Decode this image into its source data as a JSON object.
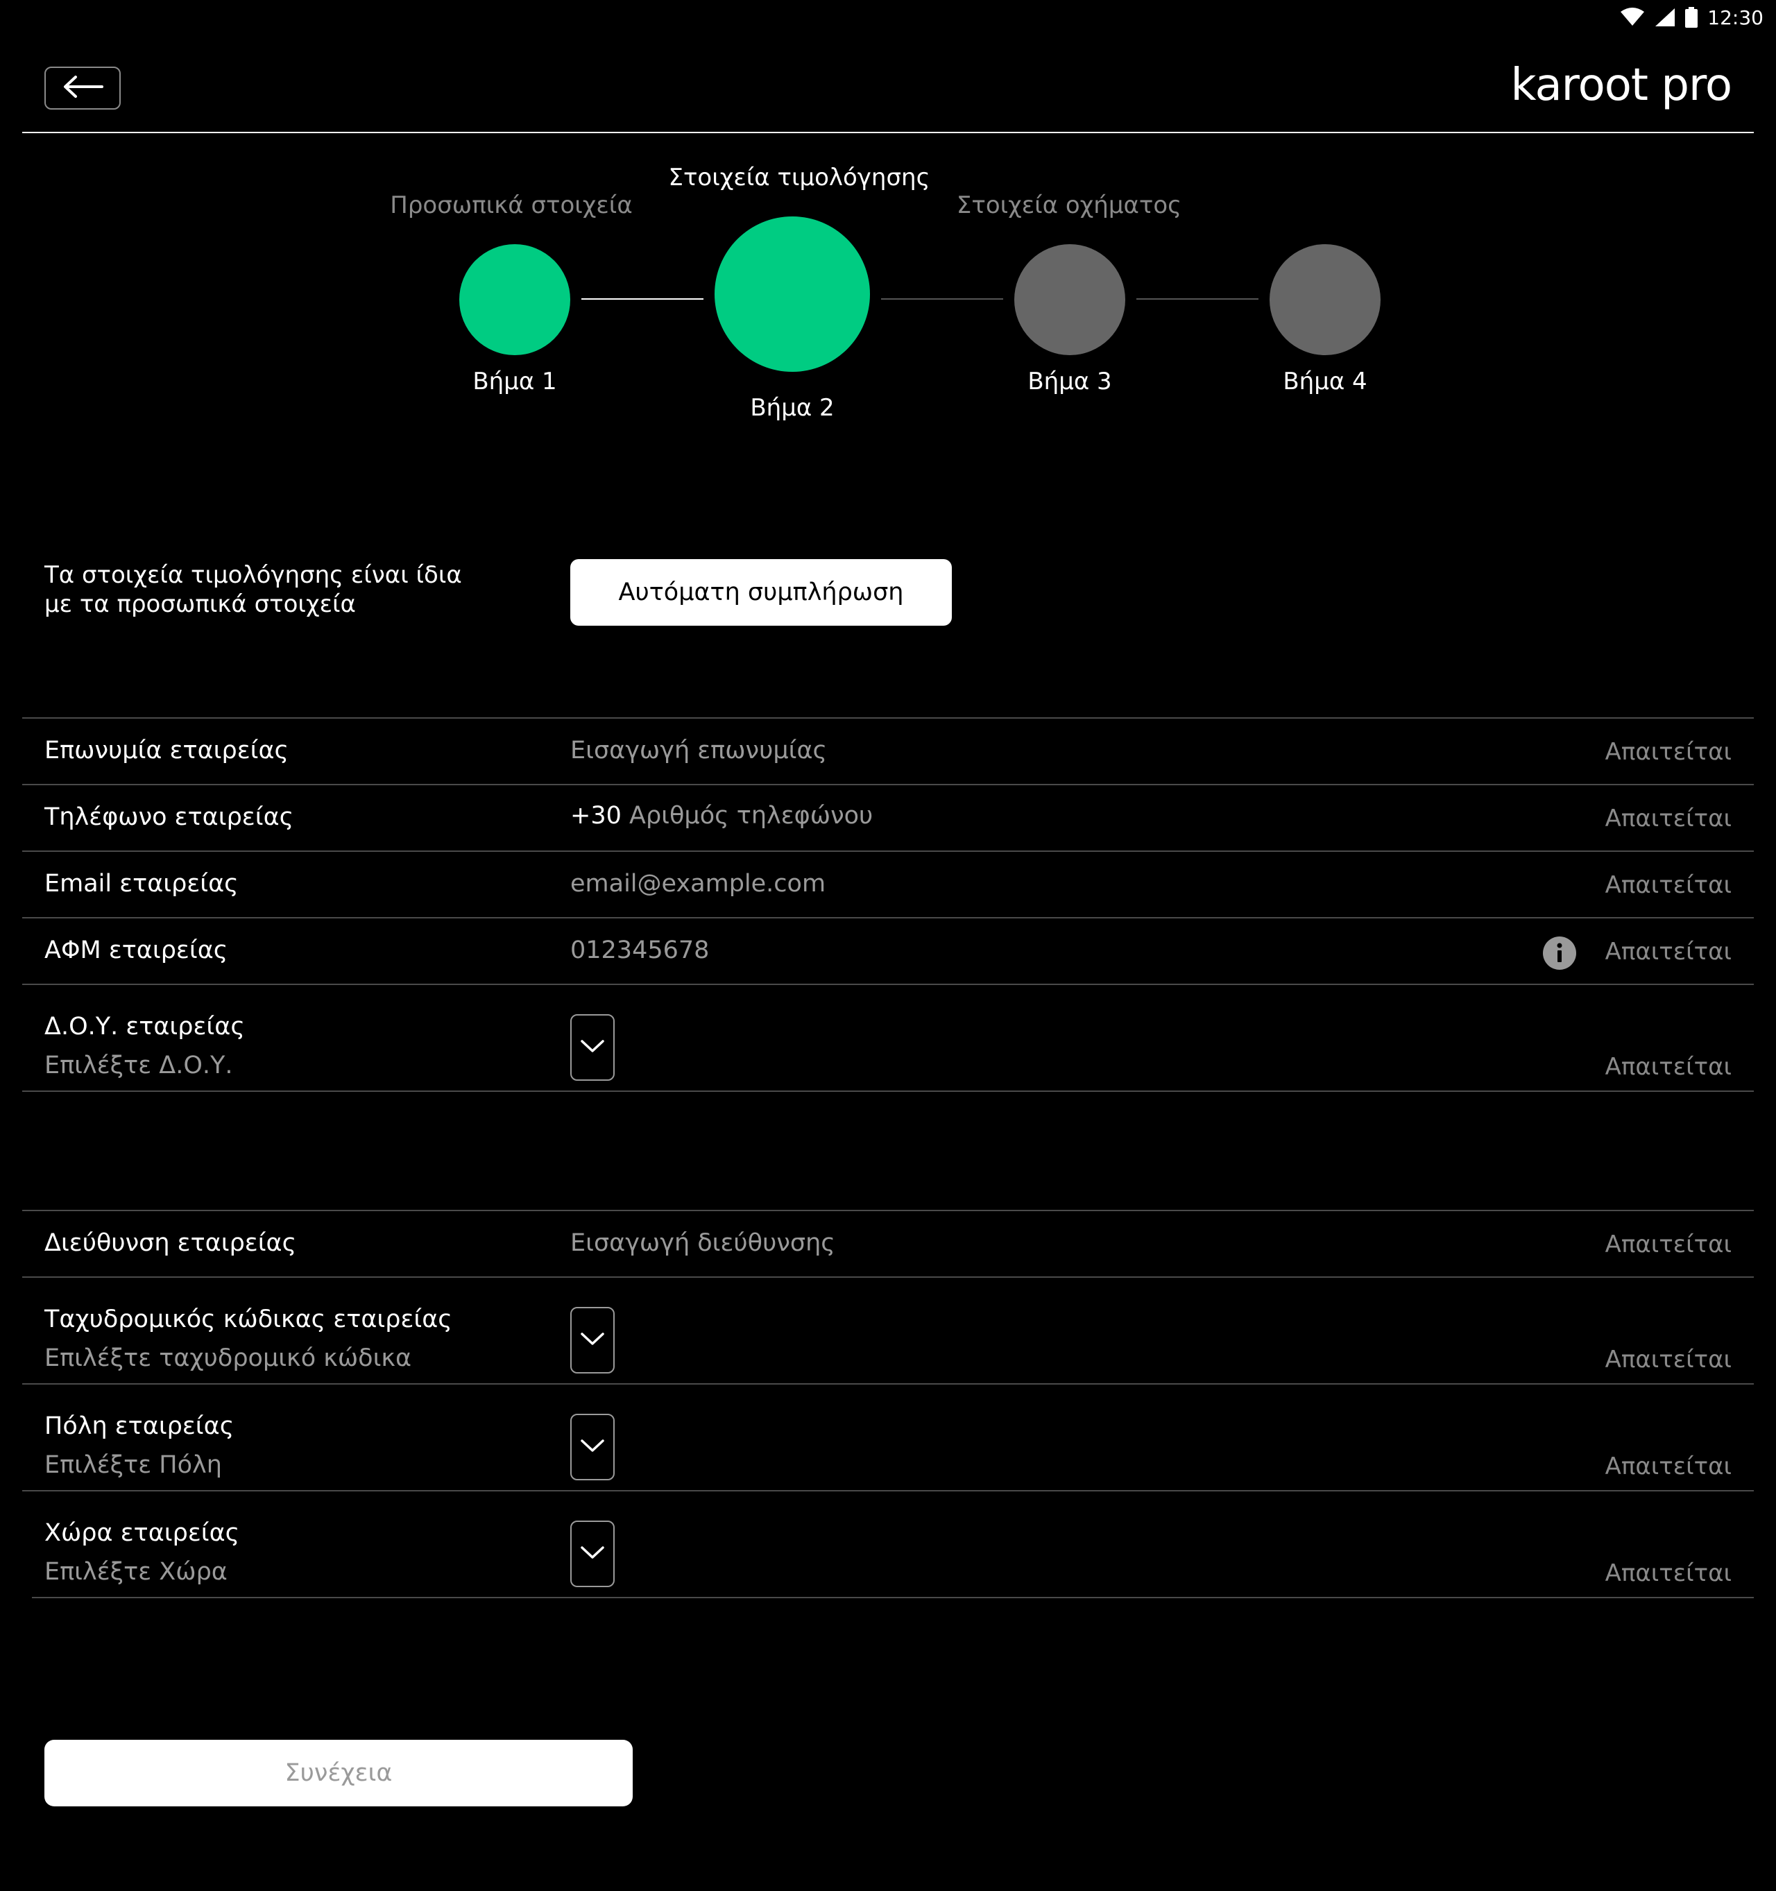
{
  "status_bar": {
    "time": "12:30"
  },
  "header": {
    "brand": "karoot pro"
  },
  "stepper": {
    "titles": {
      "step1": "Προσωπικά στοιχεία",
      "step2": "Στοιχεία τιμολόγησης",
      "step3": "Στοιχεία οχήματος"
    },
    "steps": [
      {
        "label": "Βήμα 1",
        "state": "done"
      },
      {
        "label": "Βήμα 2",
        "state": "current"
      },
      {
        "label": "Βήμα 3",
        "state": "pending"
      },
      {
        "label": "Βήμα 4",
        "state": "pending"
      }
    ]
  },
  "autofill": {
    "text_line1": "Τα στοιχεία τιμολόγησης είναι ίδια",
    "text_line2": "με τα προσωπικά στοιχεία",
    "button": "Αυτόματη συμπλήρωση"
  },
  "required_text": "Απαιτείται",
  "fields": {
    "company_name": {
      "label": "Επωνυμία εταιρείας",
      "placeholder": "Εισαγωγή επωνυμίας"
    },
    "company_phone": {
      "label": "Τηλέφωνο εταιρείας",
      "prefix": "+30",
      "placeholder": "Αριθμός τηλεφώνου"
    },
    "company_email": {
      "label": "Email εταιρείας",
      "placeholder": "email@example.com"
    },
    "company_vat": {
      "label": "ΑΦΜ εταιρείας",
      "placeholder": "012345678"
    },
    "company_tax_office": {
      "label": "Δ.Ο.Υ. εταιρείας",
      "placeholder": "Επιλέξτε Δ.Ο.Υ."
    },
    "company_address": {
      "label": "Διεύθυνση εταιρείας",
      "placeholder": "Εισαγωγή διεύθυνσης"
    },
    "company_postal_code": {
      "label": "Ταχυδρομικός κώδικας εταιρείας",
      "placeholder": "Επιλέξτε ταχυδρομικό κώδικα"
    },
    "company_city": {
      "label": "Πόλη εταιρείας",
      "placeholder": "Επιλέξτε Πόλη"
    },
    "company_country": {
      "label": "Χώρα εταιρείας",
      "placeholder": "Επιλέξτε Χώρα"
    }
  },
  "continue_button": "Συνέχεια",
  "colors": {
    "accent": "#00CC82",
    "pending": "#666666",
    "background": "#000000"
  }
}
